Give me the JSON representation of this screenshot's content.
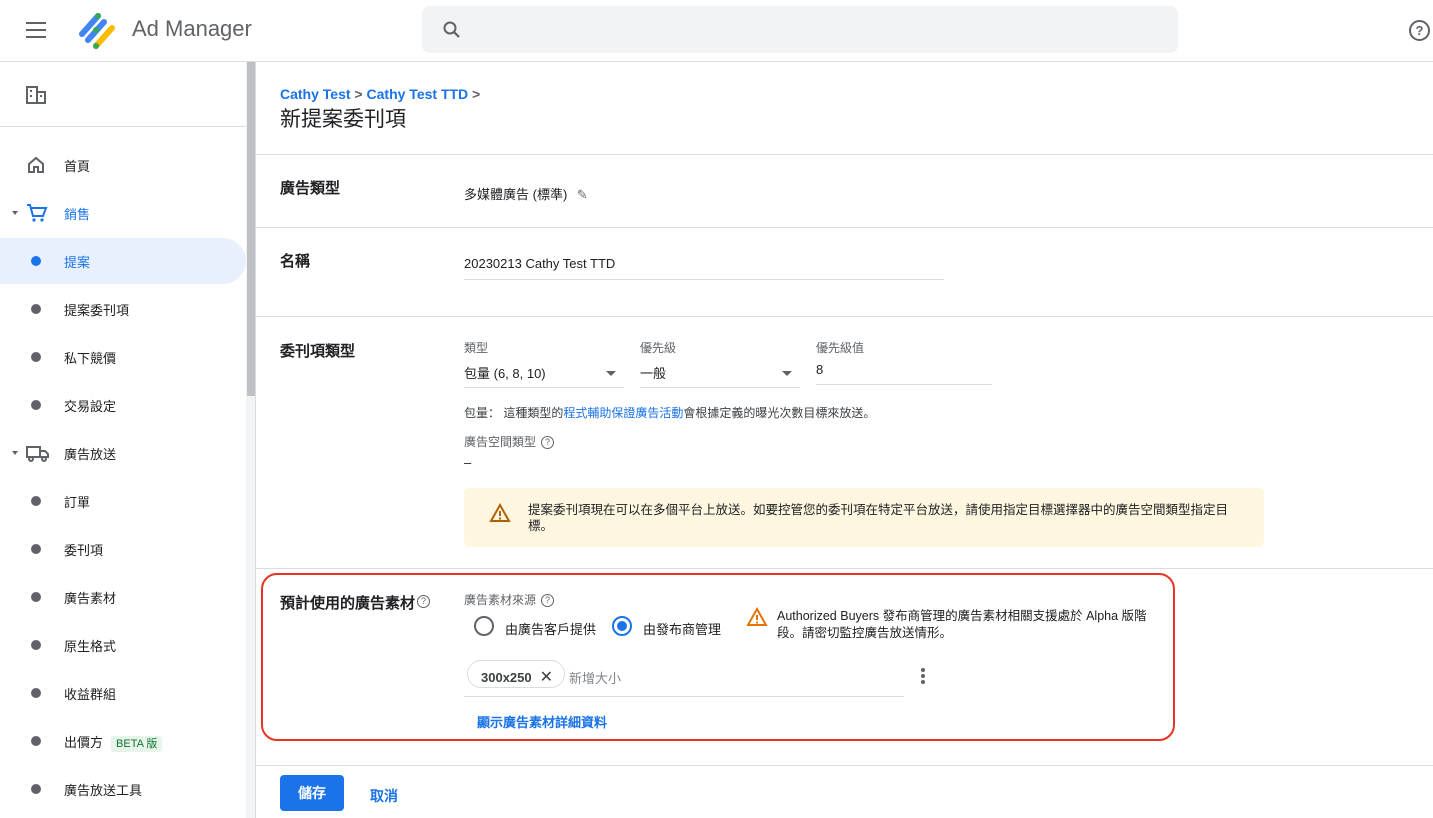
{
  "header": {
    "menu_icon": "hamburger-icon",
    "app_name": "Ad Manager",
    "search_icon": "search-icon",
    "help_icon": "help-icon"
  },
  "sidebar": {
    "network_icon": "building-icon",
    "items": [
      {
        "label": "首頁",
        "icon": "home-icon"
      },
      {
        "label": "銷售",
        "icon": "cart-icon",
        "expanded": true
      },
      {
        "label": "提案",
        "selected": true
      },
      {
        "label": "提案委刊項"
      },
      {
        "label": "私下競價"
      },
      {
        "label": "交易設定"
      },
      {
        "label": "廣告放送",
        "icon": "truck-icon",
        "expanded": true
      },
      {
        "label": "訂單"
      },
      {
        "label": "委刊項"
      },
      {
        "label": "廣告素材"
      },
      {
        "label": "原生格式"
      },
      {
        "label": "收益群組"
      },
      {
        "label": "出價方",
        "badge": "BETA 版"
      },
      {
        "label": "廣告放送工具"
      }
    ]
  },
  "breadcrumb": [
    "Cathy Test",
    "Cathy Test TTD"
  ],
  "page_title": "新提案委刊項",
  "ad_type": {
    "label": "廣告類型",
    "value": "多媒體廣告 (標準)"
  },
  "name": {
    "label": "名稱",
    "value": "20230213 Cathy Test TTD"
  },
  "line_item_type": {
    "label": "委刊項類型",
    "type_label": "類型",
    "type_value": "包量 (6, 8, 10)",
    "priority_label": "優先級",
    "priority_value": "一般",
    "priority_value_label": "優先級值",
    "priority_number": "8",
    "desc_prefix": "包量： 這種類型的",
    "desc_link": "程式輔助保證廣告活動",
    "desc_suffix": "會根據定義的曝光次數目標來放送。",
    "inventory_type_label": "廣告空間類型",
    "inventory_type_value": "–",
    "banner": "提案委刊項現在可以在多個平台上放送。如要控管您的委刊項在特定平台放送，請使用指定目標選擇器中的廣告空間類型指定目標。"
  },
  "creatives": {
    "label": "預計使用的廣告素材",
    "source_label": "廣告素材來源",
    "options": [
      {
        "label": "由廣告客戶提供",
        "selected": false
      },
      {
        "label": "由發布商管理",
        "selected": true
      }
    ],
    "warning": "Authorized Buyers 發布商管理的廣告素材相關支援處於 Alpha 版階段。請密切監控廣告放送情形。",
    "size_chip": "300x250",
    "size_placeholder": "新增大小",
    "details_link": "顯示廣告素材詳細資料"
  },
  "footer": {
    "save": "儲存",
    "cancel": "取消"
  },
  "colors": {
    "accent": "#1a73e8",
    "highlight": "#ea3323",
    "warning_bg": "#fef7e0"
  }
}
